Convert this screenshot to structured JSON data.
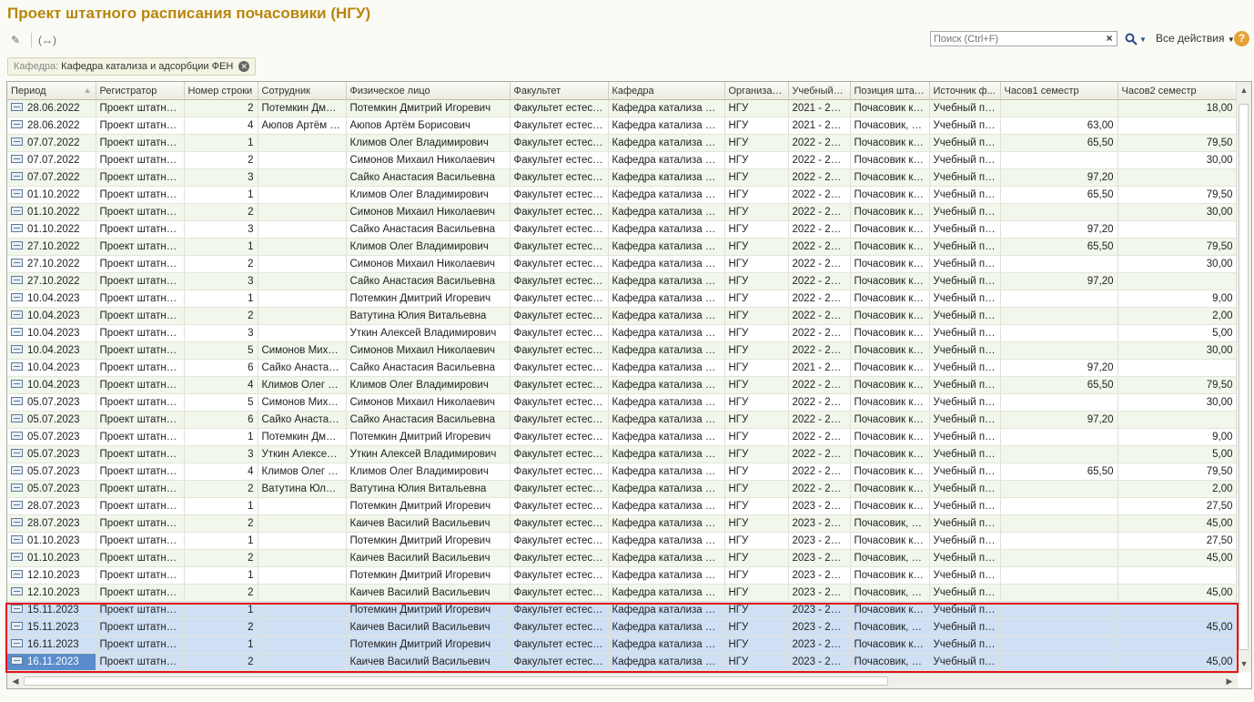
{
  "title": "Проект штатного расписания почасовики (НГУ)",
  "toolbar": {
    "edit_icon": "pencil-icon",
    "link_icon": "link-arrows-icon",
    "search_placeholder": "Поиск (Ctrl+F)",
    "search_clear": "×",
    "all_actions_label": "Все действия",
    "help_label": "?"
  },
  "filter": {
    "label": "Кафедра:",
    "value": "Кафедра катализа и адсорбции ФЕН"
  },
  "table": {
    "columns": [
      "Период",
      "Регистратор",
      "Номер строки",
      "Сотрудник",
      "Физическое лицо",
      "Факультет",
      "Кафедра",
      "Организац...",
      "Учебный г...",
      "Позиция штат...",
      "Источник ф...",
      "Часов1 семестр",
      "Часов2 семестр"
    ],
    "rows": [
      [
        "28.06.2022",
        "Проект штатног...",
        "2",
        "Потемкин Дмит...",
        "Потемкин Дмитрий Игоревич",
        "Факультет естест...",
        "Кафедра катализа и а...",
        "НГУ",
        "2021 - 2022",
        "Почасовик к.н...",
        "Учебный пр...",
        "",
        "18,00"
      ],
      [
        "28.06.2022",
        "Проект штатног...",
        "4",
        "Аюпов Артём Б...",
        "Аюпов Артём Борисович",
        "Факультет естест...",
        "Кафедра катализа и а...",
        "НГУ",
        "2021 - 2022",
        "Почасовик, Н...",
        "Учебный пр...",
        "63,00",
        ""
      ],
      [
        "07.07.2022",
        "Проект штатног...",
        "1",
        "",
        "Климов Олег Владимирович",
        "Факультет естест...",
        "Кафедра катализа и а...",
        "НГУ",
        "2022 - 2023",
        "Почасовик к.н...",
        "Учебный пр...",
        "65,50",
        "79,50"
      ],
      [
        "07.07.2022",
        "Проект штатног...",
        "2",
        "",
        "Симонов Михаил Николаевич",
        "Факультет естест...",
        "Кафедра катализа и а...",
        "НГУ",
        "2022 - 2023",
        "Почасовик к.н...",
        "Учебный пр...",
        "",
        "30,00"
      ],
      [
        "07.07.2022",
        "Проект штатног...",
        "3",
        "",
        "Сайко Анастасия Васильевна",
        "Факультет естест...",
        "Кафедра катализа и а...",
        "НГУ",
        "2022 - 2023",
        "Почасовик к.н...",
        "Учебный пр...",
        "97,20",
        ""
      ],
      [
        "01.10.2022",
        "Проект штатног...",
        "1",
        "",
        "Климов Олег Владимирович",
        "Факультет естест...",
        "Кафедра катализа и а...",
        "НГУ",
        "2022 - 2023",
        "Почасовик к.н...",
        "Учебный пр...",
        "65,50",
        "79,50"
      ],
      [
        "01.10.2022",
        "Проект штатног...",
        "2",
        "",
        "Симонов Михаил Николаевич",
        "Факультет естест...",
        "Кафедра катализа и а...",
        "НГУ",
        "2022 - 2023",
        "Почасовик к.н...",
        "Учебный пр...",
        "",
        "30,00"
      ],
      [
        "01.10.2022",
        "Проект штатног...",
        "3",
        "",
        "Сайко Анастасия Васильевна",
        "Факультет естест...",
        "Кафедра катализа и а...",
        "НГУ",
        "2022 - 2023",
        "Почасовик к.н...",
        "Учебный пр...",
        "97,20",
        ""
      ],
      [
        "27.10.2022",
        "Проект штатног...",
        "1",
        "",
        "Климов Олег Владимирович",
        "Факультет естест...",
        "Кафедра катализа и а...",
        "НГУ",
        "2022 - 2023",
        "Почасовик к.н...",
        "Учебный пр...",
        "65,50",
        "79,50"
      ],
      [
        "27.10.2022",
        "Проект штатног...",
        "2",
        "",
        "Симонов Михаил Николаевич",
        "Факультет естест...",
        "Кафедра катализа и а...",
        "НГУ",
        "2022 - 2023",
        "Почасовик к.н...",
        "Учебный пр...",
        "",
        "30,00"
      ],
      [
        "27.10.2022",
        "Проект штатног...",
        "3",
        "",
        "Сайко Анастасия Васильевна",
        "Факультет естест...",
        "Кафедра катализа и а...",
        "НГУ",
        "2022 - 2023",
        "Почасовик к.н...",
        "Учебный пр...",
        "97,20",
        ""
      ],
      [
        "10.04.2023",
        "Проект штатног...",
        "1",
        "",
        "Потемкин Дмитрий Игоревич",
        "Факультет естест...",
        "Кафедра катализа и а...",
        "НГУ",
        "2022 - 2023",
        "Почасовик к.н...",
        "Учебный пр...",
        "",
        "9,00"
      ],
      [
        "10.04.2023",
        "Проект штатног...",
        "2",
        "",
        "Ватутина Юлия Витальевна",
        "Факультет естест...",
        "Кафедра катализа и а...",
        "НГУ",
        "2022 - 2023",
        "Почасовик к.н...",
        "Учебный пр...",
        "",
        "2,00"
      ],
      [
        "10.04.2023",
        "Проект штатног...",
        "3",
        "",
        "Уткин Алексей Владимирович",
        "Факультет естест...",
        "Кафедра катализа и а...",
        "НГУ",
        "2022 - 2023",
        "Почасовик к.н...",
        "Учебный пр...",
        "",
        "5,00"
      ],
      [
        "10.04.2023",
        "Проект штатног...",
        "5",
        "Симонов Михаи...",
        "Симонов Михаил Николаевич",
        "Факультет естест...",
        "Кафедра катализа и а...",
        "НГУ",
        "2022 - 2023",
        "Почасовик к.н...",
        "Учебный пр...",
        "",
        "30,00"
      ],
      [
        "10.04.2023",
        "Проект штатног...",
        "6",
        "Сайко Анастаси...",
        "Сайко Анастасия Васильевна",
        "Факультет естест...",
        "Кафедра катализа и а...",
        "НГУ",
        "2021 - 2023",
        "Почасовик к.н...",
        "Учебный пр...",
        "97,20",
        ""
      ],
      [
        "10.04.2023",
        "Проект штатног...",
        "4",
        "Климов Олег В...",
        "Климов Олег Владимирович",
        "Факультет естест...",
        "Кафедра катализа и а...",
        "НГУ",
        "2022 - 2023",
        "Почасовик к.н...",
        "Учебный пр...",
        "65,50",
        "79,50"
      ],
      [
        "05.07.2023",
        "Проект штатног...",
        "5",
        "Симонов Михаи...",
        "Симонов Михаил Николаевич",
        "Факультет естест...",
        "Кафедра катализа и а...",
        "НГУ",
        "2022 - 2023",
        "Почасовик к.н...",
        "Учебный пр...",
        "",
        "30,00"
      ],
      [
        "05.07.2023",
        "Проект штатног...",
        "6",
        "Сайко Анастаси...",
        "Сайко Анастасия Васильевна",
        "Факультет естест...",
        "Кафедра катализа и а...",
        "НГУ",
        "2022 - 2023",
        "Почасовик к.н...",
        "Учебный пр...",
        "97,20",
        ""
      ],
      [
        "05.07.2023",
        "Проект штатног...",
        "1",
        "Потемкин Дмит...",
        "Потемкин Дмитрий Игоревич",
        "Факультет естест...",
        "Кафедра катализа и а...",
        "НГУ",
        "2022 - 2023",
        "Почасовик к.н...",
        "Учебный пр...",
        "",
        "9,00"
      ],
      [
        "05.07.2023",
        "Проект штатног...",
        "3",
        "Уткин Алексей ...",
        "Уткин Алексей Владимирович",
        "Факультет естест...",
        "Кафедра катализа и а...",
        "НГУ",
        "2022 - 2023",
        "Почасовик к.н...",
        "Учебный пр...",
        "",
        "5,00"
      ],
      [
        "05.07.2023",
        "Проект штатног...",
        "4",
        "Климов Олег В...",
        "Климов Олег Владимирович",
        "Факультет естест...",
        "Кафедра катализа и а...",
        "НГУ",
        "2022 - 2023",
        "Почасовик к.н...",
        "Учебный пр...",
        "65,50",
        "79,50"
      ],
      [
        "05.07.2023",
        "Проект штатног...",
        "2",
        "Ватутина Юлия ...",
        "Ватутина Юлия Витальевна",
        "Факультет естест...",
        "Кафедра катализа и а...",
        "НГУ",
        "2022 - 2023",
        "Почасовик к.н...",
        "Учебный пр...",
        "",
        "2,00"
      ],
      [
        "28.07.2023",
        "Проект штатног...",
        "1",
        "",
        "Потемкин Дмитрий Игоревич",
        "Факультет естест...",
        "Кафедра катализа и а...",
        "НГУ",
        "2023 - 2024",
        "Почасовик к.н...",
        "Учебный пр...",
        "",
        "27,50"
      ],
      [
        "28.07.2023",
        "Проект штатног...",
        "2",
        "",
        "Каичев Василий Васильевич",
        "Факультет естест...",
        "Кафедра катализа и а...",
        "НГУ",
        "2023 - 2024",
        "Почасовик, Н...",
        "Учебный пр...",
        "",
        "45,00"
      ],
      [
        "01.10.2023",
        "Проект штатног...",
        "1",
        "",
        "Потемкин Дмитрий Игоревич",
        "Факультет естест...",
        "Кафедра катализа и а...",
        "НГУ",
        "2023 - 2024",
        "Почасовик к.н...",
        "Учебный пр...",
        "",
        "27,50"
      ],
      [
        "01.10.2023",
        "Проект штатног...",
        "2",
        "",
        "Каичев Василий Васильевич",
        "Факультет естест...",
        "Кафедра катализа и а...",
        "НГУ",
        "2023 - 2024",
        "Почасовик, Н...",
        "Учебный пр...",
        "",
        "45,00"
      ],
      [
        "12.10.2023",
        "Проект штатног...",
        "1",
        "",
        "Потемкин Дмитрий Игоревич",
        "Факультет естест...",
        "Кафедра катализа и а...",
        "НГУ",
        "2023 - 2024",
        "Почасовик к.н...",
        "Учебный пр...",
        "",
        ""
      ],
      [
        "12.10.2023",
        "Проект штатног...",
        "2",
        "",
        "Каичев Василий Васильевич",
        "Факультет естест...",
        "Кафедра катализа и а...",
        "НГУ",
        "2023 - 2024",
        "Почасовик, Н...",
        "Учебный пр...",
        "",
        "45,00"
      ],
      [
        "15.11.2023",
        "Проект штатног...",
        "1",
        "",
        "Потемкин Дмитрий Игоревич",
        "Факультет естест...",
        "Кафедра катализа и а...",
        "НГУ",
        "2023 - 2024",
        "Почасовик к.н...",
        "Учебный пр...",
        "",
        ""
      ],
      [
        "15.11.2023",
        "Проект штатног...",
        "2",
        "",
        "Каичев Василий Васильевич",
        "Факультет естест...",
        "Кафедра катализа и а...",
        "НГУ",
        "2023 - 2024",
        "Почасовик, Н...",
        "Учебный пр...",
        "",
        "45,00"
      ],
      [
        "16.11.2023",
        "Проект штатног...",
        "1",
        "",
        "Потемкин Дмитрий Игоревич",
        "Факультет естест...",
        "Кафедра катализа и а...",
        "НГУ",
        "2023 - 2024",
        "Почасовик к.н...",
        "Учебный пр...",
        "",
        ""
      ],
      [
        "16.11.2023",
        "Проект штатног...",
        "2",
        "",
        "Каичев Василий Васильевич",
        "Факультет естест...",
        "Кафедра катализа и а...",
        "НГУ",
        "2023 - 2024",
        "Почасовик, Н...",
        "Учебный пр...",
        "",
        "45,00"
      ]
    ],
    "selected_rows": [
      29,
      30,
      31,
      32
    ],
    "current_row": 32
  },
  "colors": {
    "title": "#b8860b",
    "selection": "#cfe0f4",
    "current_cell": "#5b8ccc",
    "highlight_border": "#e3141a",
    "alt_row": "#f2f7ec"
  }
}
